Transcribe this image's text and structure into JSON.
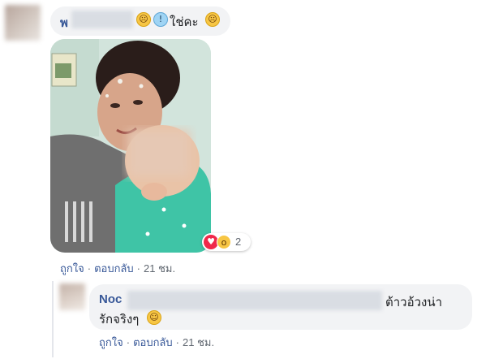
{
  "comment": {
    "author": "พ",
    "text": "ใช่คะ",
    "emojis": [
      "worried-face",
      "screaming-face",
      "worried-face"
    ],
    "reactions": {
      "icons": [
        "love",
        "wow"
      ],
      "count": "2"
    },
    "actions": {
      "like": "ถูกใจ",
      "reply": "ตอบกลับ",
      "time": "21 ชม.",
      "separator": "·"
    }
  },
  "reply": {
    "author": "Noc",
    "text_line1": "ต้าวอ้วงน่า",
    "text_line2": "รักจริงๆ",
    "emoji": "grinning-squinting-face",
    "actions": {
      "like": "ถูกใจ",
      "reply": "ตอบกลับ",
      "time": "21 ชม.",
      "separator": "·"
    }
  },
  "colors": {
    "author": "#385898",
    "bubble": "#f2f3f5",
    "meta_text": "#606770",
    "love": "#f0284a",
    "wow": "#f7c644"
  }
}
